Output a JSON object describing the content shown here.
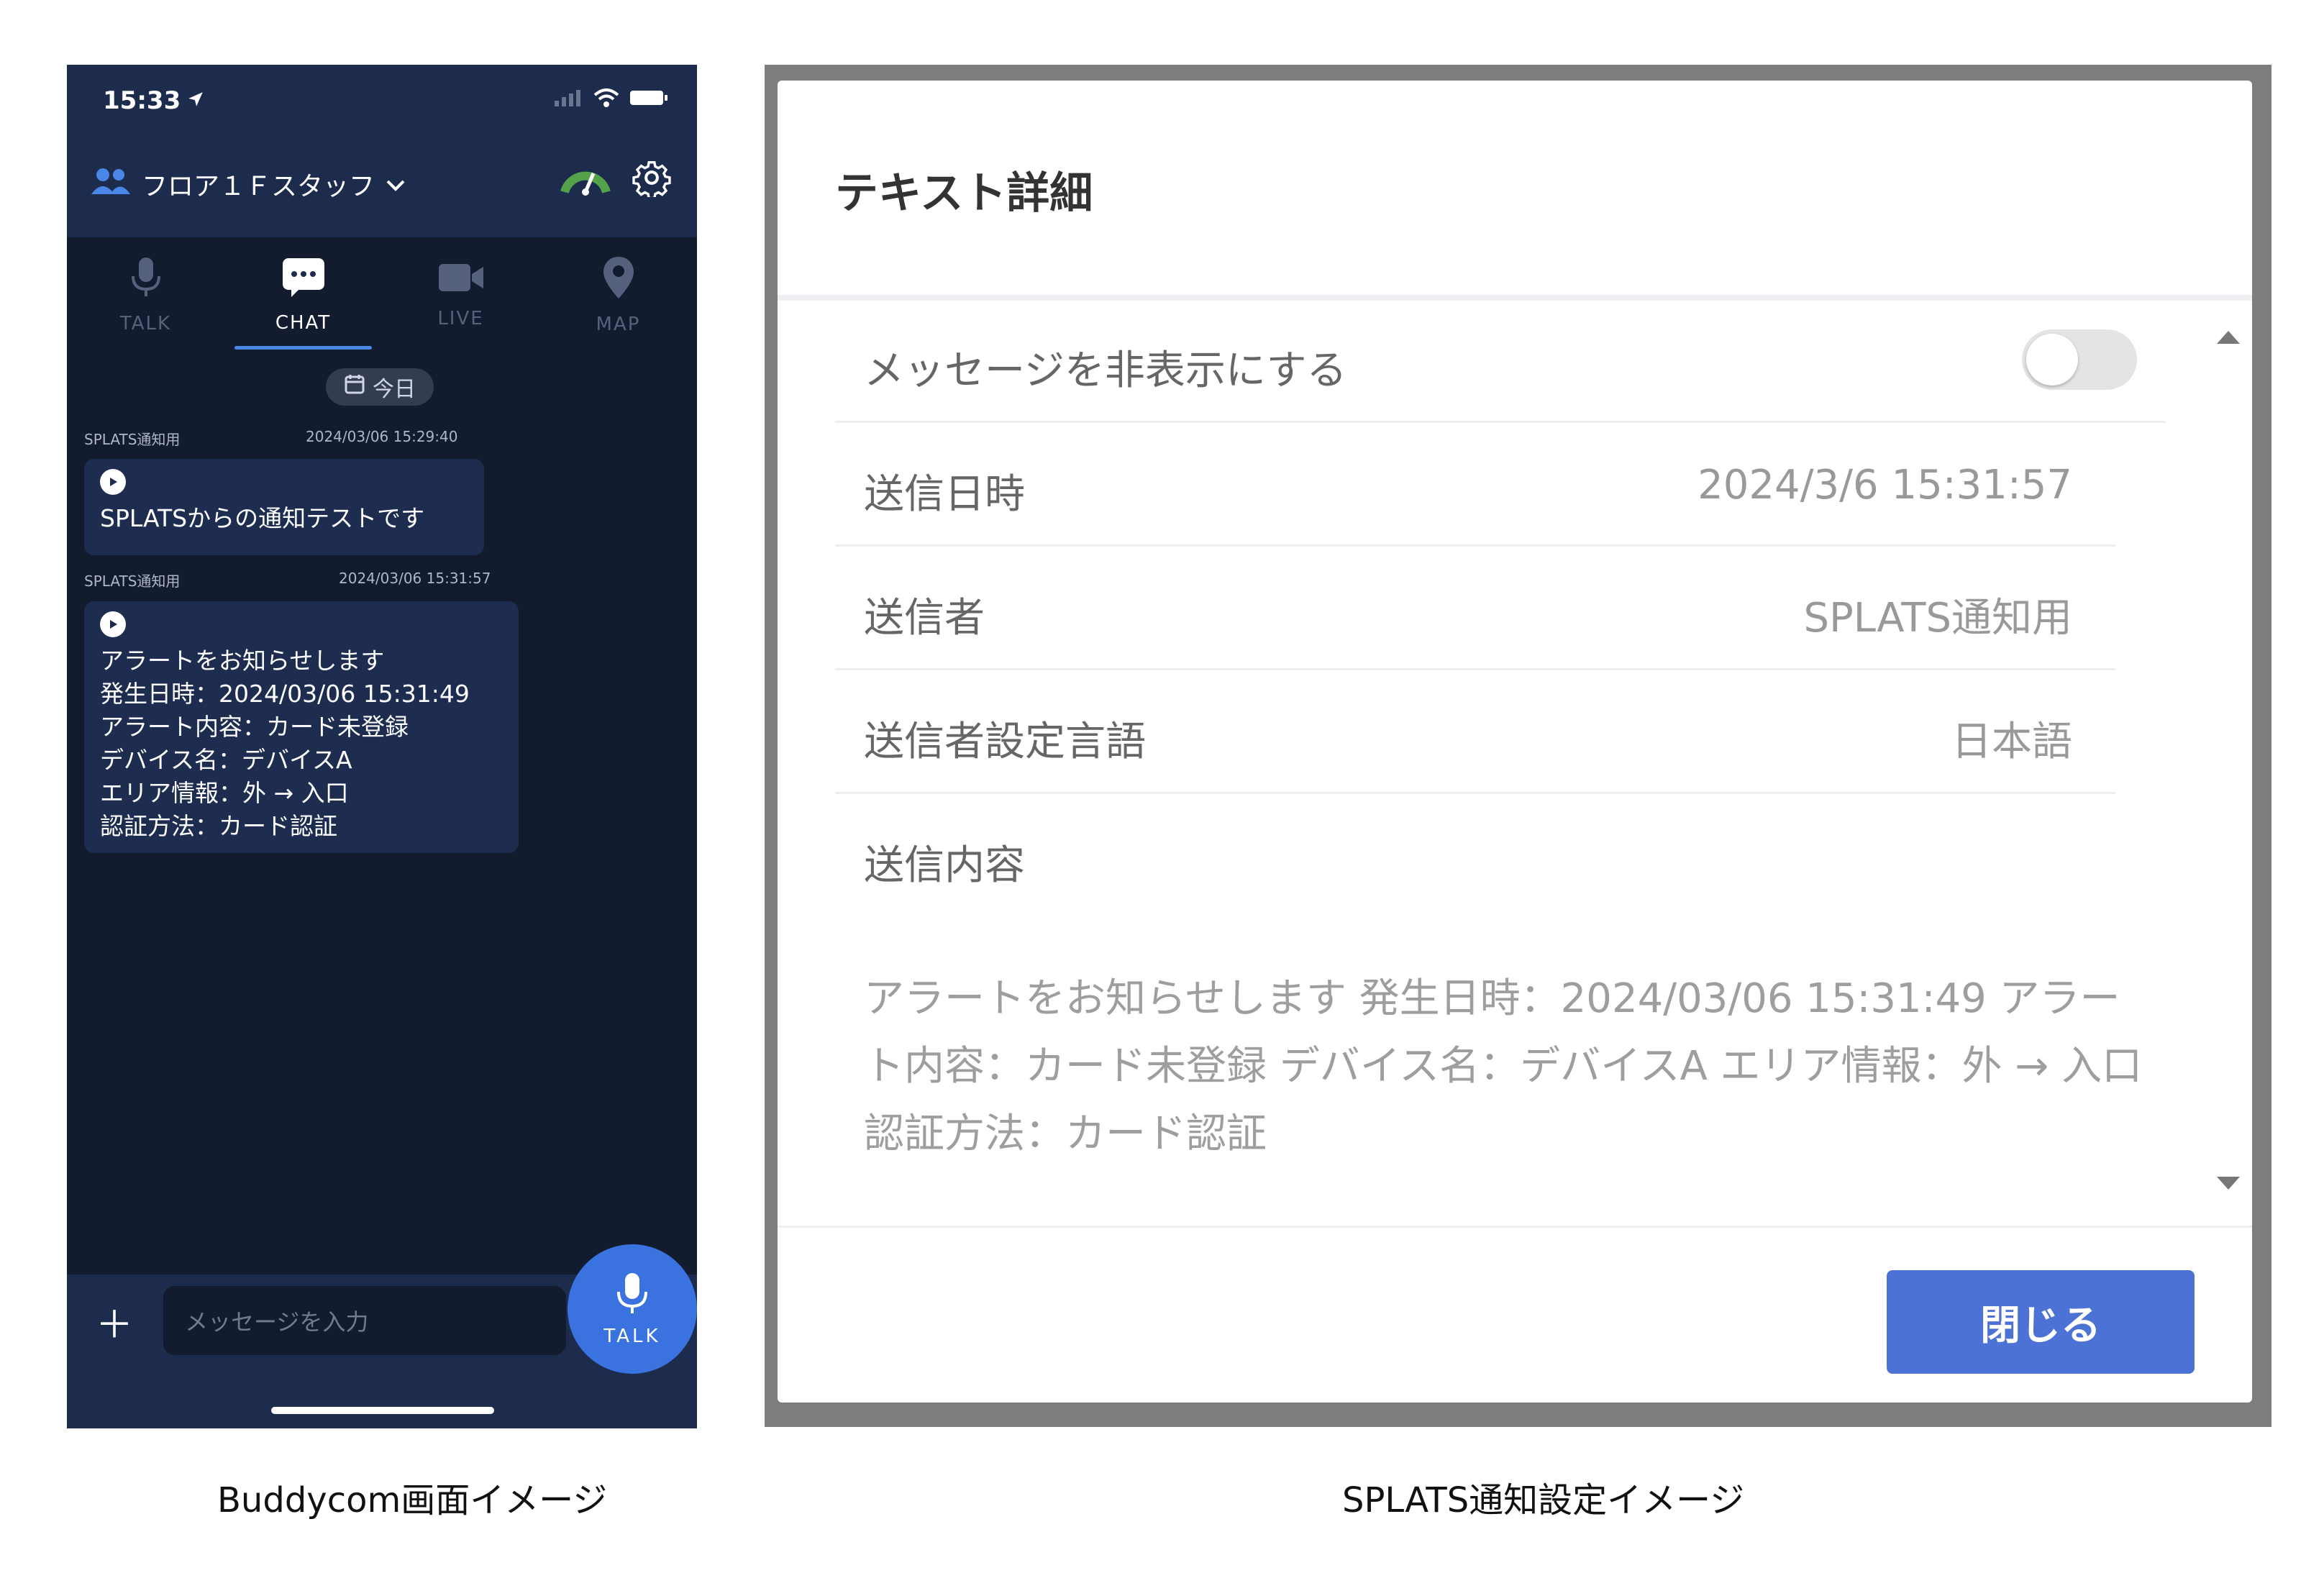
{
  "phone": {
    "status_time": "15:33",
    "group_name": "フロア１Ｆスタッフ",
    "tabs": [
      {
        "label": "TALK",
        "active": false
      },
      {
        "label": "CHAT",
        "active": true
      },
      {
        "label": "LIVE",
        "active": false
      },
      {
        "label": "MAP",
        "active": false
      }
    ],
    "date_chip": "今日",
    "messages": [
      {
        "sender": "SPLATS通知用",
        "timestamp": "2024/03/06 15:29:40",
        "text": "SPLATSからの通知テストです"
      },
      {
        "sender": "SPLATS通知用",
        "timestamp": "2024/03/06 15:31:57",
        "text": "アラートをお知らせします\n発生日時：2024/03/06 15:31:49\nアラート内容：カード未登録\nデバイス名：デバイスA\nエリア情報：外 → 入口\n認証方法：カード認証"
      }
    ],
    "input_placeholder": "メッセージを入力",
    "talk_label": "TALK",
    "colors": {
      "accent": "#3a73e0",
      "header_bg": "#1d2b4c",
      "screen_bg": "#131b2e"
    }
  },
  "dialog": {
    "title": "テキスト詳細",
    "hide_label": "メッセージを非表示にする",
    "hide_enabled": false,
    "fields": [
      {
        "label": "送信日時",
        "value": "2024/3/6 15:31:57"
      },
      {
        "label": "送信者",
        "value": "SPLATS通知用"
      },
      {
        "label": "送信者設定言語",
        "value": "日本語"
      }
    ],
    "content_label": "送信内容",
    "content_text": "アラートをお知らせします 発生日時：2024/03/06 15:31:49 アラート内容：カード未登録 デバイス名：デバイスA エリア情報：外 → 入口 認証方法：カード認証",
    "close_label": "閉じる",
    "colors": {
      "button": "#4b72d4"
    }
  },
  "captions": {
    "left": "Buddycom画面イメージ",
    "right": "SPLATS通知設定イメージ"
  }
}
